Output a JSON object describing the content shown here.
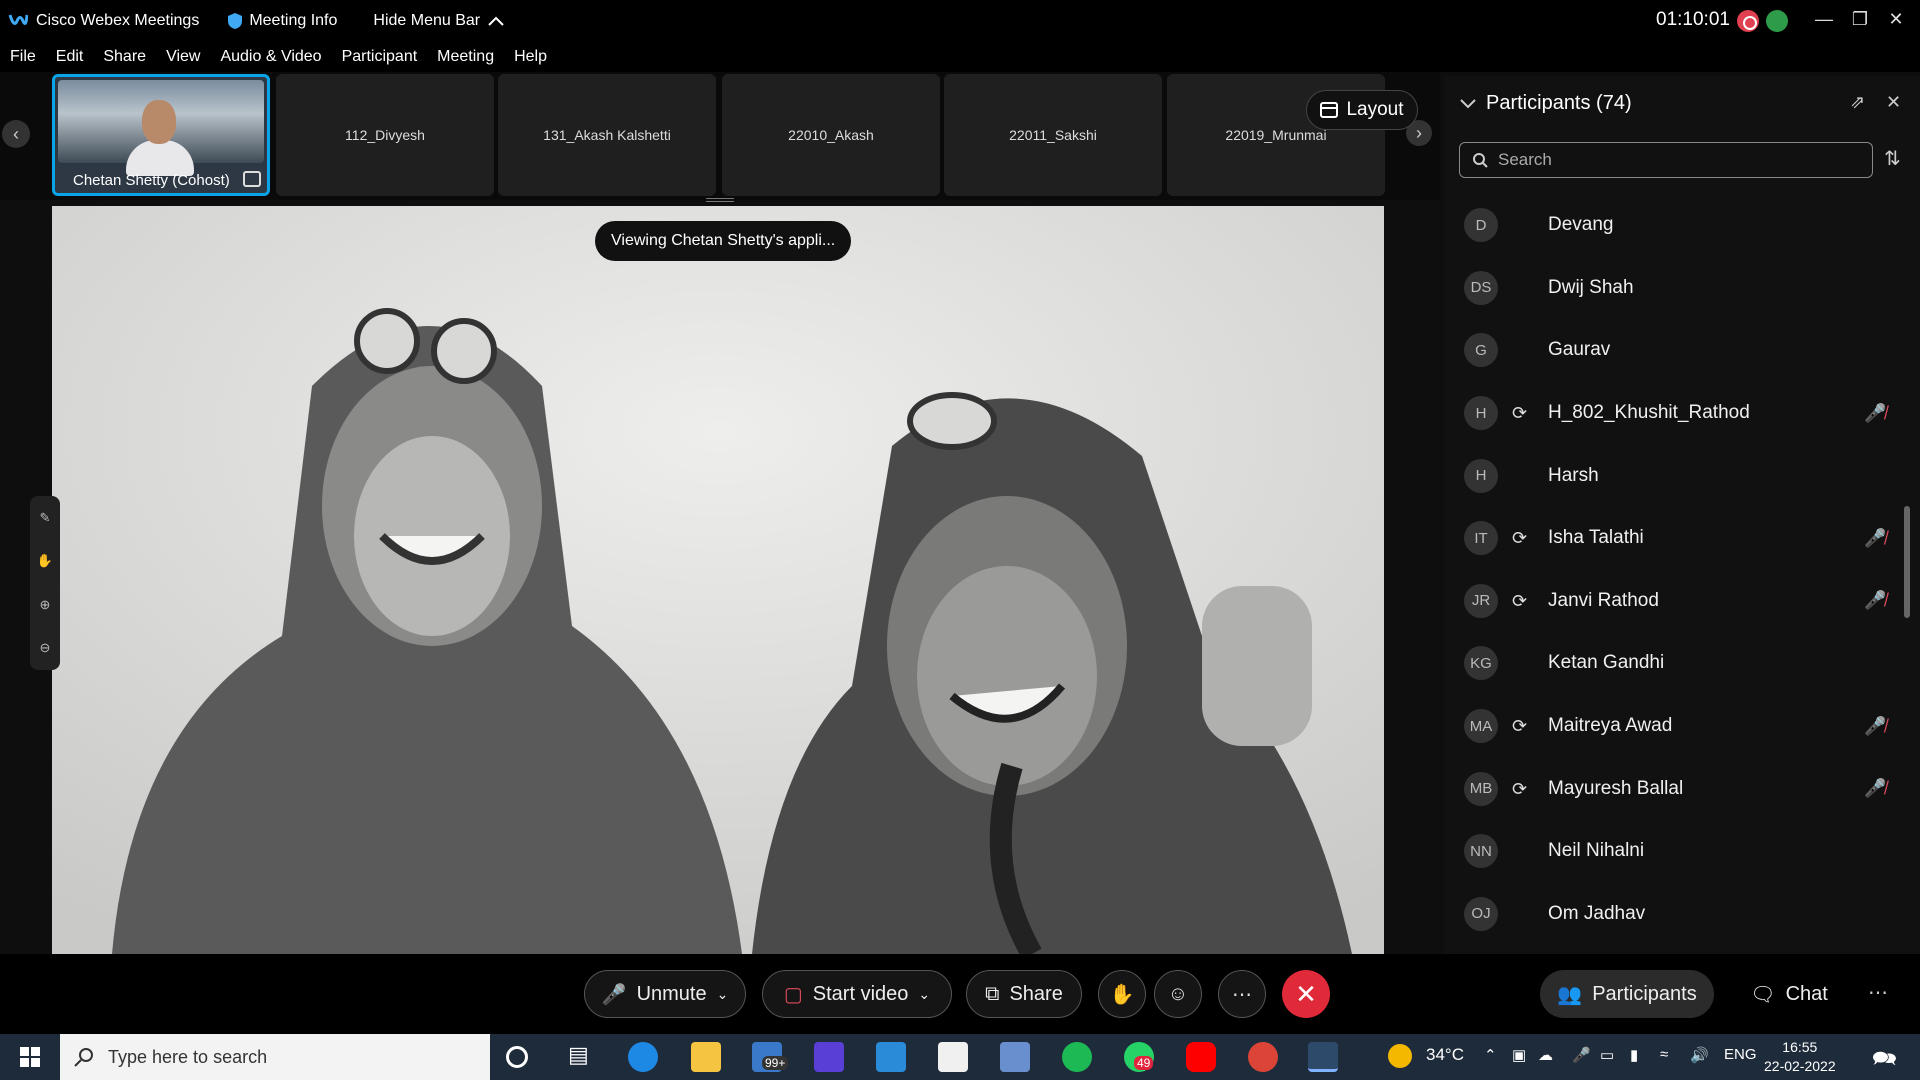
{
  "titlebar": {
    "app_name": "Cisco Webex Meetings",
    "meeting_info": "Meeting Info",
    "hide_menu": "Hide Menu Bar",
    "clock": "01:10:01"
  },
  "menu": [
    "File",
    "Edit",
    "Share",
    "View",
    "Audio & Video",
    "Participant",
    "Meeting",
    "Help"
  ],
  "filmstrip": {
    "host_label": "Chetan Shetty  (Cohost)",
    "tiles": [
      "112_Divyesh",
      "131_Akash Kalshetti",
      "22010_Akash",
      "22011_Sakshi",
      "22019_Mrunmai"
    ],
    "layout_label": "Layout"
  },
  "share_banner": "Viewing Chetan Shetty's appli...",
  "participants_panel": {
    "title": "Participants (74)",
    "search_placeholder": "Search",
    "items": [
      {
        "initials": "D",
        "name": "Devang",
        "sync": false,
        "muted": false
      },
      {
        "initials": "DS",
        "name": "Dwij Shah",
        "sync": false,
        "muted": false
      },
      {
        "initials": "G",
        "name": "Gaurav",
        "sync": false,
        "muted": false
      },
      {
        "initials": "H",
        "name": "H_802_Khushit_Rathod",
        "sync": true,
        "muted": true
      },
      {
        "initials": "H",
        "name": "Harsh",
        "sync": false,
        "muted": false
      },
      {
        "initials": "IT",
        "name": "Isha Talathi",
        "sync": true,
        "muted": true
      },
      {
        "initials": "JR",
        "name": "Janvi Rathod",
        "sync": true,
        "muted": true
      },
      {
        "initials": "KG",
        "name": "Ketan Gandhi",
        "sync": false,
        "muted": false
      },
      {
        "initials": "MA",
        "name": "Maitreya Awad",
        "sync": true,
        "muted": true
      },
      {
        "initials": "MB",
        "name": "Mayuresh Ballal",
        "sync": true,
        "muted": true
      },
      {
        "initials": "NN",
        "name": "Neil Nihalni",
        "sync": false,
        "muted": false
      },
      {
        "initials": "OJ",
        "name": "Om Jadhav",
        "sync": false,
        "muted": false
      }
    ]
  },
  "controls": {
    "unmute": "Unmute",
    "start_video": "Start video",
    "share": "Share",
    "participants": "Participants",
    "chat": "Chat"
  },
  "taskbar": {
    "search_placeholder": "Type here to search",
    "mail_badge": "99+",
    "whatsapp_badge": "49",
    "temperature": "34°C",
    "language": "ENG",
    "time": "16:55",
    "date": "22-02-2022"
  },
  "colors": {
    "accent": "#0aa5e8",
    "end_call": "#e02a3a",
    "muted_icon": "#e04c5e"
  }
}
